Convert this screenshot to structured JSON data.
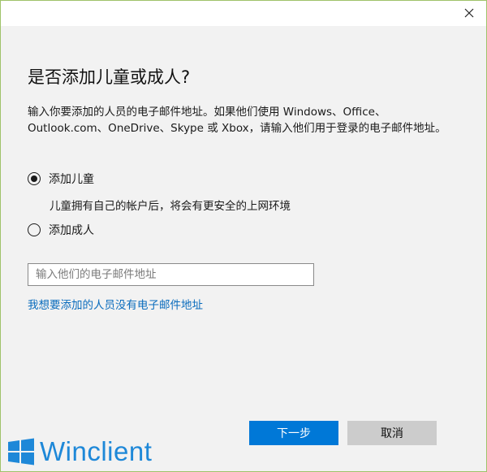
{
  "dialog": {
    "close_icon": "close-icon",
    "heading": "是否添加儿童或成人?",
    "description": "输入你要添加的人员的电子邮件地址。如果他们使用 Windows、Office、Outlook.com、OneDrive、Skype 或 Xbox，请输入他们用于登录的电子邮件地址。",
    "options": [
      {
        "label": "添加儿童",
        "selected": true,
        "description": "儿童拥有自己的帐户后，将会有更安全的上网环境"
      },
      {
        "label": "添加成人",
        "selected": false
      }
    ],
    "email_placeholder": "输入他们的电子邮件地址",
    "email_value": "",
    "no_email_link": "我想要添加的人员没有电子邮件地址",
    "next_button": "下一步",
    "cancel_button": "取消"
  },
  "watermark": {
    "logo_icon": "windows-logo-icon",
    "text": "Winclient"
  },
  "colors": {
    "accent": "#0078d7",
    "link": "#0a6cbd",
    "background": "#f2f2f2",
    "cancel": "#cccccc",
    "watermark": "#1e88d8"
  }
}
